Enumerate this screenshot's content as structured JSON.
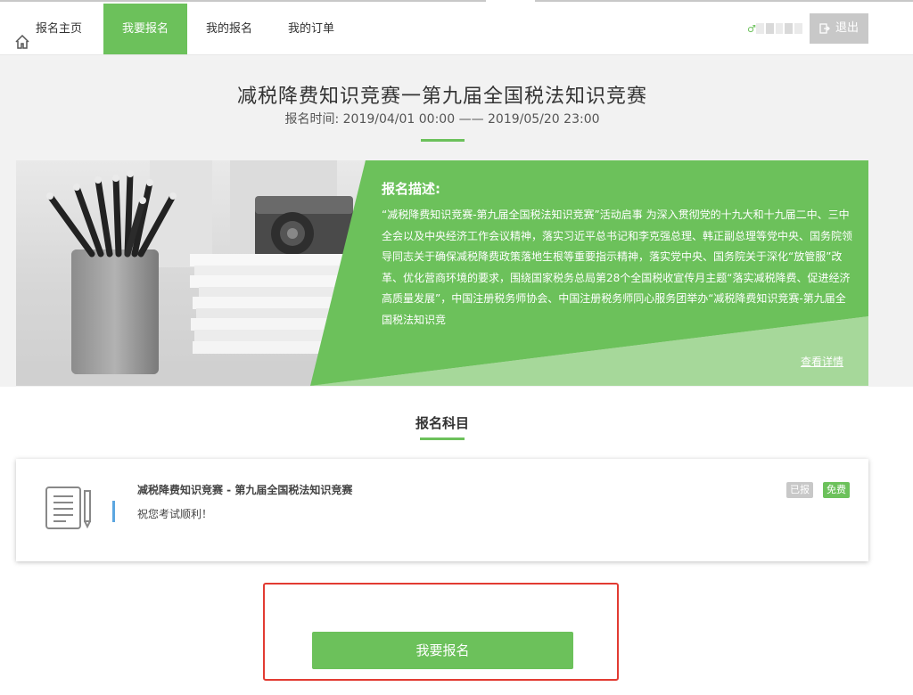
{
  "nav": {
    "home_label": "报名主页",
    "items": [
      {
        "label": "我要报名"
      },
      {
        "label": "我的报名"
      },
      {
        "label": "我的订单"
      }
    ],
    "logout_label": "退出"
  },
  "header": {
    "title": "减税降费知识竞赛一第九届全国税法知识竞赛",
    "time_text": "报名时间: 2019/04/01 00:00 —— 2019/05/20 23:00"
  },
  "banner": {
    "desc_title": "报名描述:",
    "desc_text": "“减税降费知识竞赛-第九届全国税法知识竞赛”活动启事 为深入贯彻党的十九大和十九届二中、三中全会以及中央经济工作会议精神，落实习近平总书记和李克强总理、韩正副总理等党中央、国务院领导同志关于确保减税降费政策落地生根等重要指示精神，落实党中央、国务院关于深化“放管服”改革、优化营商环境的要求，围绕国家税务总局第28个全国税收宣传月主题“落实减税降费、促进经济高质量发展”，中国注册税务师协会、中国注册税务师同心服务团举办“减税降费知识竞赛-第九届全国税法知识竞",
    "more_label": "查看详情"
  },
  "section": {
    "title": "报名科目"
  },
  "subject": {
    "title": "减税降费知识竞赛 - 第九届全国税法知识竞赛",
    "subtitle": "祝您考试顺利！",
    "badge_done": "已报",
    "badge_free": "免费"
  },
  "action": {
    "signup_label": "我要报名"
  },
  "colors": {
    "accent": "#6cc15b",
    "highlight_border": "#e23b32",
    "disabled": "#c8c8c8"
  }
}
